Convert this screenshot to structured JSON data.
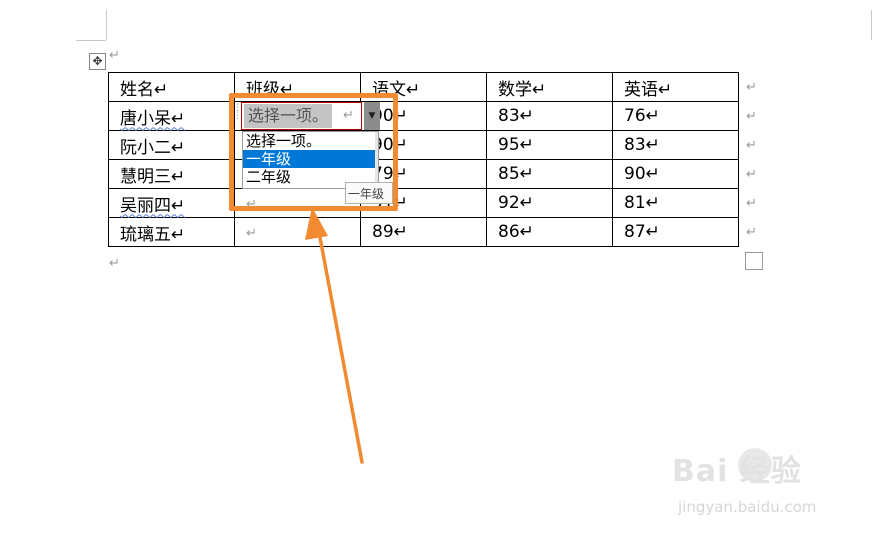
{
  "table": {
    "headers": [
      "姓名↵",
      "班级↵",
      "语文↵",
      "数学↵",
      "英语↵"
    ],
    "rows": [
      [
        "唐小呆↵",
        "",
        "90↵",
        "83↵",
        "76↵"
      ],
      [
        "阮小二↵",
        "",
        "90↵",
        "95↵",
        "83↵"
      ],
      [
        "慧明三↵",
        "",
        "79↵",
        "85↵",
        "90↵"
      ],
      [
        "吴丽四↵",
        "↵",
        "91↵",
        "92↵",
        "81↵"
      ],
      [
        "琉璃五↵",
        "↵",
        "89↵",
        "86↵",
        "87↵"
      ]
    ],
    "row_end_marks": [
      "↵",
      "↵",
      "↵",
      "↵",
      "↵",
      "↵"
    ]
  },
  "marks": {
    "top_paragraph": "↵",
    "end_paragraph": "↵",
    "move_handle": "✥"
  },
  "content_control": {
    "placeholder": "选择一项。",
    "pilcrow": "↵",
    "arrow": "▼",
    "options": [
      "选择一项。",
      "一年级",
      "二年级"
    ],
    "selected_index": 1,
    "tooltip": "一年级"
  },
  "watermark": {
    "brand": "Bai  经验",
    "site": "jingyan.baidu.com"
  },
  "colors": {
    "highlight": "#f28a31",
    "selection": "#0078d7",
    "control_border": "#c00000"
  }
}
